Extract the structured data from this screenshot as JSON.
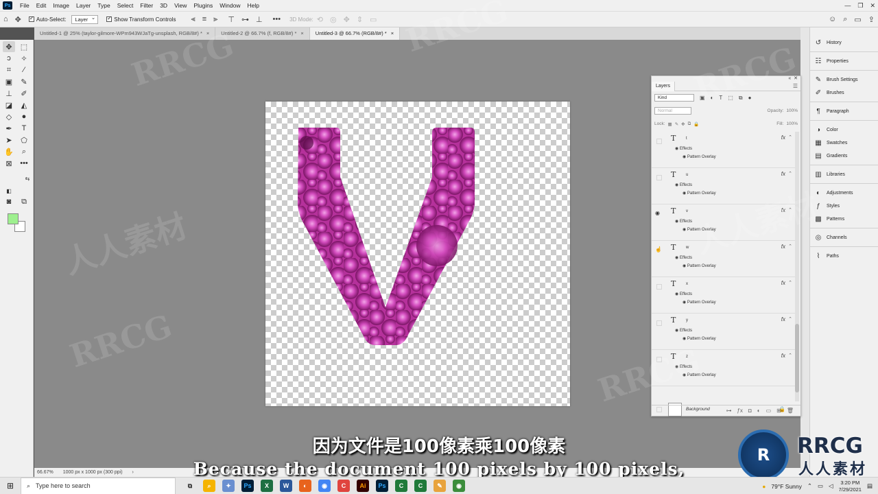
{
  "app": {
    "name": "Ps"
  },
  "menu": [
    "File",
    "Edit",
    "Image",
    "Layer",
    "Type",
    "Select",
    "Filter",
    "3D",
    "View",
    "Plugins",
    "Window",
    "Help"
  ],
  "window_controls": {
    "minimize": "—",
    "restore": "❐",
    "close": "✕"
  },
  "options_bar": {
    "auto_select_label": "Auto-Select:",
    "auto_select_value": "Layer",
    "show_transform_label": "Show Transform Controls",
    "mode_3d_label": "3D Mode:"
  },
  "tabs": [
    {
      "label": "Untitled-1 @ 25% (taylor-gilmore-WPm943WJaTg-unsplash, RGB/8#) *",
      "close": "×"
    },
    {
      "label": "Untitled-2 @ 66.7% (f, RGB/8#) *",
      "close": "×"
    },
    {
      "label": "Untitled-3 @ 66.7% (RGB/8#) *",
      "close": "×"
    }
  ],
  "statusbar": {
    "zoom": "66.67%",
    "doc_info": "1000 px x 1000 px (300 ppi)",
    "arrow": "›"
  },
  "colors": {
    "foreground": "#9ef08f",
    "background": "#ffffff",
    "flower_main": "#c43aa8",
    "flower_dark": "#7a1464"
  },
  "right_panels": [
    {
      "label": "History",
      "icon": "history-icon"
    },
    {
      "label": "Properties",
      "icon": "properties-icon"
    },
    {
      "label": "Brush Settings",
      "icon": "brush-settings-icon"
    },
    {
      "label": "Brushes",
      "icon": "brushes-icon"
    },
    {
      "label": "Paragraph",
      "icon": "paragraph-icon"
    },
    {
      "label": "Color",
      "icon": "color-icon"
    },
    {
      "label": "Swatches",
      "icon": "swatches-icon"
    },
    {
      "label": "Gradients",
      "icon": "gradients-icon"
    },
    {
      "label": "Libraries",
      "icon": "libraries-icon"
    },
    {
      "label": "Adjustments",
      "icon": "adjustments-icon"
    },
    {
      "label": "Styles",
      "icon": "styles-icon"
    },
    {
      "label": "Patterns",
      "icon": "patterns-icon"
    },
    {
      "label": "Channels",
      "icon": "channels-icon"
    },
    {
      "label": "Paths",
      "icon": "paths-icon"
    }
  ],
  "layers_panel": {
    "title": "Layers",
    "kind": "Kind",
    "blend_mode": "Normal",
    "opacity_label": "Opacity:",
    "opacity_value": "100%",
    "lock_label": "Lock:",
    "fill_label": "Fill:",
    "fill_value": "100%",
    "layers": [
      {
        "name": "t",
        "visible": false,
        "effects_label": "Effects",
        "effect": "Pattern Overlay",
        "fx": "fx"
      },
      {
        "name": "u",
        "visible": false,
        "effects_label": "Effects",
        "effect": "Pattern Overlay",
        "fx": "fx"
      },
      {
        "name": "v",
        "visible": true,
        "effects_label": "Effects",
        "effect": "Pattern Overlay",
        "fx": "fx"
      },
      {
        "name": "w",
        "visible": false,
        "effects_label": "Effects",
        "effect": "Pattern Overlay",
        "fx": "fx"
      },
      {
        "name": "x",
        "visible": false,
        "effects_label": "Effects",
        "effect": "Pattern Overlay",
        "fx": "fx"
      },
      {
        "name": "y",
        "visible": false,
        "effects_label": "Effects",
        "effect": "Pattern Overlay",
        "fx": "fx"
      },
      {
        "name": "z",
        "visible": false,
        "effects_label": "Effects",
        "effect": "Pattern Overlay",
        "fx": "fx"
      }
    ],
    "background_layer": "Background"
  },
  "subtitles": {
    "zh": "因为文件是100像素乘100像素",
    "en": "Because the document 100 pixels by 100 pixels,"
  },
  "watermark": {
    "brand": "RRCG",
    "brand_cn": "人人素材"
  },
  "taskbar": {
    "search_placeholder": "Type here to search",
    "weather": "79°F  Sunny",
    "time": "3:20 PM",
    "date": "7/29/2021"
  }
}
